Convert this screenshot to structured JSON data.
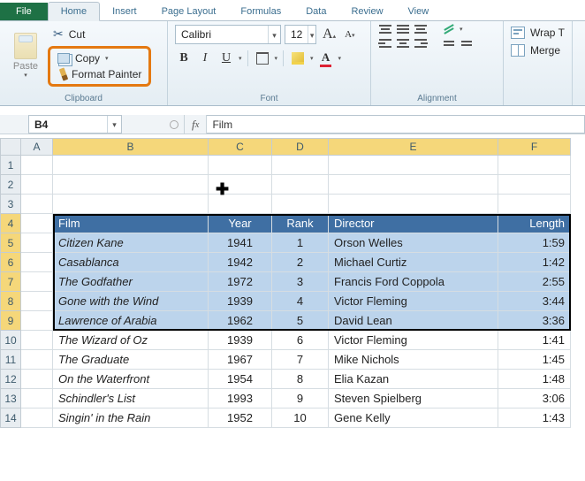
{
  "ribbon": {
    "tabs": {
      "file": "File",
      "home": "Home",
      "insert": "Insert",
      "page_layout": "Page Layout",
      "formulas": "Formulas",
      "data": "Data",
      "review": "Review",
      "view": "View"
    },
    "clipboard": {
      "paste": "Paste",
      "cut": "Cut",
      "copy": "Copy",
      "format_painter": "Format Painter",
      "group_label": "Clipboard"
    },
    "font": {
      "name": "Calibri",
      "size": "12",
      "group_label": "Font"
    },
    "alignment": {
      "group_label": "Alignment"
    },
    "extras": {
      "wrap": "Wrap T",
      "merge": "Merge"
    }
  },
  "namebox": "B4",
  "formula": "Film",
  "columns": [
    "A",
    "B",
    "C",
    "D",
    "E",
    "F"
  ],
  "row_nums": [
    "1",
    "2",
    "3",
    "4",
    "5",
    "6",
    "7",
    "8",
    "9",
    "10",
    "11",
    "12",
    "13",
    "14"
  ],
  "table": {
    "headers": {
      "film": "Film",
      "year": "Year",
      "rank": "Rank",
      "director": "Director",
      "length": "Length"
    },
    "rows": [
      {
        "film": "Citizen Kane",
        "year": "1941",
        "rank": "1",
        "director": "Orson Welles",
        "length": "1:59"
      },
      {
        "film": "Casablanca",
        "year": "1942",
        "rank": "2",
        "director": "Michael Curtiz",
        "length": "1:42"
      },
      {
        "film": "The Godfather",
        "year": "1972",
        "rank": "3",
        "director": "Francis Ford Coppola",
        "length": "2:55"
      },
      {
        "film": "Gone with the Wind",
        "year": "1939",
        "rank": "4",
        "director": "Victor Fleming",
        "length": "3:44"
      },
      {
        "film": "Lawrence of Arabia",
        "year": "1962",
        "rank": "5",
        "director": "David Lean",
        "length": "3:36"
      },
      {
        "film": "The Wizard of Oz",
        "year": "1939",
        "rank": "6",
        "director": "Victor Fleming",
        "length": "1:41"
      },
      {
        "film": "The Graduate",
        "year": "1967",
        "rank": "7",
        "director": "Mike Nichols",
        "length": "1:45"
      },
      {
        "film": "On the Waterfront",
        "year": "1954",
        "rank": "8",
        "director": "Elia Kazan",
        "length": "1:48"
      },
      {
        "film": "Schindler's List",
        "year": "1993",
        "rank": "9",
        "director": "Steven Spielberg",
        "length": "3:06"
      },
      {
        "film": "Singin' in the Rain",
        "year": "1952",
        "rank": "10",
        "director": "Gene Kelly",
        "length": "1:43"
      }
    ]
  }
}
